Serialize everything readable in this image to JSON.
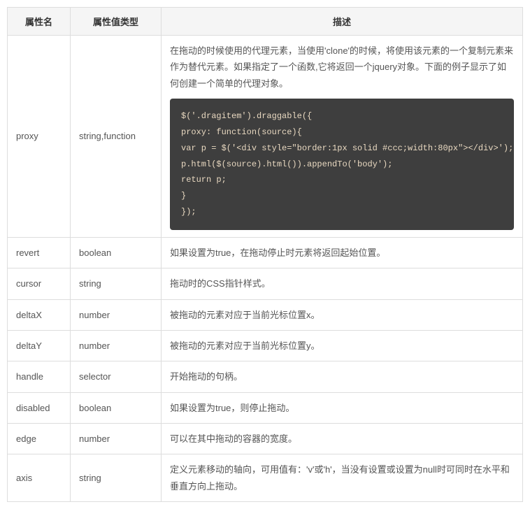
{
  "table": {
    "headers": {
      "name": "属性名",
      "type": "属性值类型",
      "desc": "描述"
    },
    "rows": [
      {
        "name": "proxy",
        "type": "string,function",
        "desc": "在拖动的时候使用的代理元素，当使用'clone'的时候，将使用该元素的一个复制元素来作为替代元素。如果指定了一个函数,它将返回一个jquery对象。下面的例子显示了如何创建一个简单的代理对象。",
        "code": "$('.dragitem').draggable({\nproxy: function(source){\nvar p = $('<div style=\"border:1px solid #ccc;width:80px\"></div>');\np.html($(source).html()).appendTo('body');\nreturn p;\n}\n});"
      },
      {
        "name": "revert",
        "type": "boolean",
        "desc": "如果设置为true，在拖动停止时元素将返回起始位置。"
      },
      {
        "name": "cursor",
        "type": "string",
        "desc": "拖动时的CSS指针样式。"
      },
      {
        "name": "deltaX",
        "type": "number",
        "desc": "被拖动的元素对应于当前光标位置x。"
      },
      {
        "name": "deltaY",
        "type": "number",
        "desc": "被拖动的元素对应于当前光标位置y。"
      },
      {
        "name": "handle",
        "type": "selector",
        "desc": "开始拖动的句柄。"
      },
      {
        "name": "disabled",
        "type": "boolean",
        "desc": "如果设置为true，则停止拖动。"
      },
      {
        "name": "edge",
        "type": "number",
        "desc": "可以在其中拖动的容器的宽度。"
      },
      {
        "name": "axis",
        "type": "string",
        "desc": "定义元素移动的轴向，可用值有：'v'或'h'，当没有设置或设置为null时可同时在水平和垂直方向上拖动。"
      }
    ]
  }
}
